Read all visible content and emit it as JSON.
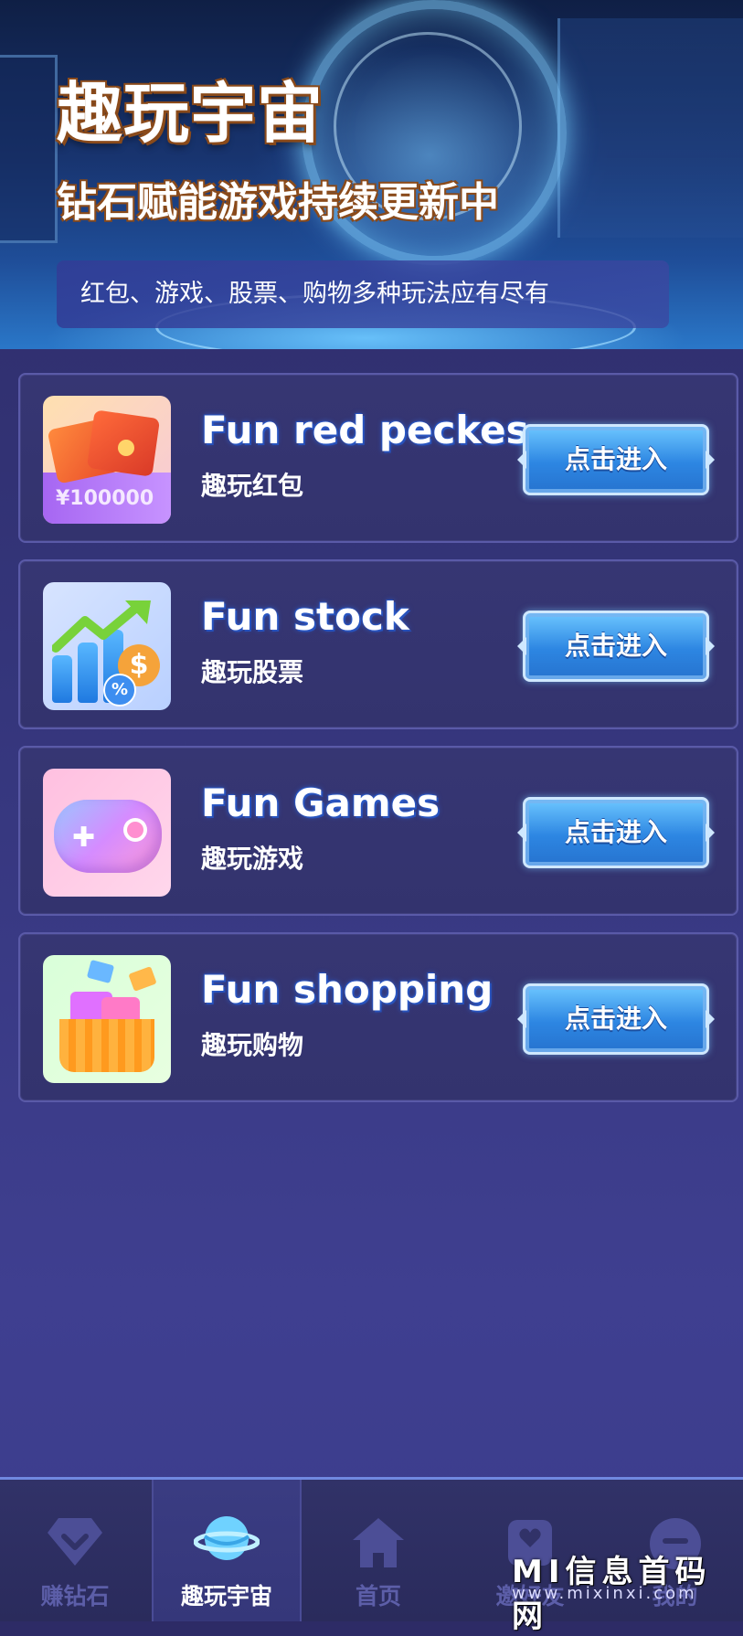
{
  "hero": {
    "title": "趣玩宇宙",
    "subtitle": "钻石赋能游戏持续更新中",
    "tagline": "红包、游戏、股票、购物多种玩法应有尽有"
  },
  "cards": [
    {
      "title": "Fun red peckes",
      "subtitle": "趣玩红包",
      "button": "点击进入",
      "thumb_text": "¥100000",
      "thumb_icon": "red-envelope-icon"
    },
    {
      "title": "Fun stock",
      "subtitle": "趣玩股票",
      "button": "点击进入",
      "thumb_icon": "stock-chart-icon"
    },
    {
      "title": "Fun Games",
      "subtitle": "趣玩游戏",
      "button": "点击进入",
      "thumb_icon": "gamepad-icon"
    },
    {
      "title": "Fun shopping",
      "subtitle": "趣玩购物",
      "button": "点击进入",
      "thumb_icon": "shopping-basket-icon"
    }
  ],
  "bottom_nav": {
    "items": [
      {
        "label": "赚钻石",
        "icon": "diamond-icon",
        "active": false
      },
      {
        "label": "趣玩宇宙",
        "icon": "planet-icon",
        "active": true
      },
      {
        "label": "首页",
        "icon": "home-icon",
        "active": false
      },
      {
        "label": "邀好友",
        "icon": "invite-friend-icon",
        "active": false
      },
      {
        "label": "我的",
        "icon": "profile-icon",
        "active": false
      }
    ]
  },
  "watermark": {
    "text": "MI信息首码网",
    "url": "www.mixinxi.com"
  },
  "colors": {
    "background": "#34357a",
    "card_border": "#5a5aa8",
    "button": "#2d86e2",
    "nav_inactive": "#5c5ea8"
  }
}
